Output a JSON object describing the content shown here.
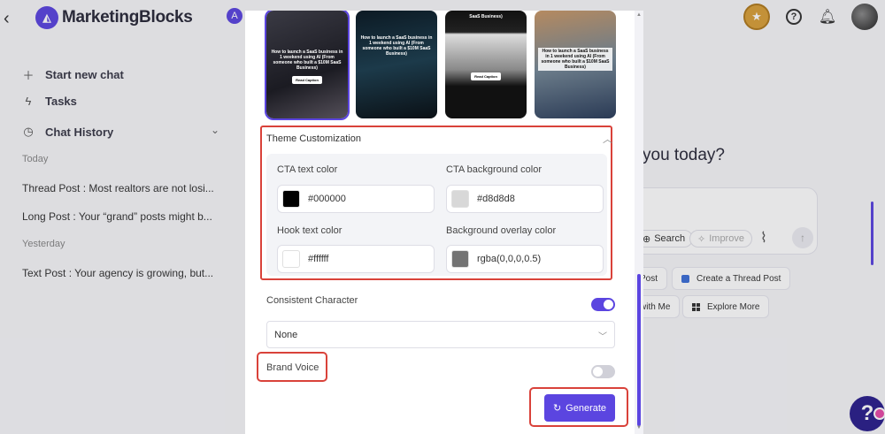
{
  "app": {
    "brand": "MarketingBlocks",
    "workspace_initial": "A"
  },
  "sidebar": {
    "new_chat": "Start new chat",
    "tasks": "Tasks",
    "chat_history": "Chat History",
    "sections": [
      {
        "label": "Today",
        "chats": [
          "Thread Post : Most realtors are not losi...",
          "Long Post : Your “grand” posts might b..."
        ]
      },
      {
        "label": "Yesterday",
        "chats": [
          "Text Post : Your agency is growing, but..."
        ]
      }
    ]
  },
  "main": {
    "greeting": "you today?",
    "input_buttons": {
      "search": "Search",
      "improve": "Improve"
    },
    "chips": [
      "Post",
      "Create a Thread Post",
      "with Me",
      "Explore More"
    ]
  },
  "modal": {
    "thumbnails": [
      {
        "text": "How to launch a SaaS business in 1 weekend using AI (From someone who built a $10M SaaS Business)",
        "button": "Read Caption",
        "selected": true
      },
      {
        "text": "How to launch a SaaS business in 1 weekend using AI (From someone who built a $10M SaaS Business)",
        "button": "",
        "selected": false
      },
      {
        "text": "SaaS Business)",
        "button": "Read Caption",
        "selected": false
      },
      {
        "text": "How to launch a SaaS business in 1 weekend using AI (From someone who built a $10M SaaS Business)",
        "button": "",
        "selected": false
      }
    ],
    "theme_title": "Theme Customization",
    "theme_fields": {
      "cta_text": {
        "label": "CTA text color",
        "value": "#000000"
      },
      "cta_bg": {
        "label": "CTA background color",
        "value": "#d8d8d8"
      },
      "hook_text": {
        "label": "Hook text color",
        "value": "#ffffff"
      },
      "overlay": {
        "label": "Background overlay color",
        "value": "rgba(0,0,0,0.5)"
      }
    },
    "consistent_character": {
      "label": "Consistent Character",
      "enabled": true,
      "selected": "None"
    },
    "brand_voice": {
      "label": "Brand Voice",
      "enabled": false
    },
    "generate": "Generate"
  },
  "colors": {
    "accent": "#5b45e0",
    "highlight": "#d9423a",
    "cta_text_swatch": "#000000",
    "cta_bg_swatch": "#d8d8d8",
    "hook_text_swatch": "#ffffff",
    "overlay_swatch": "#737373"
  }
}
